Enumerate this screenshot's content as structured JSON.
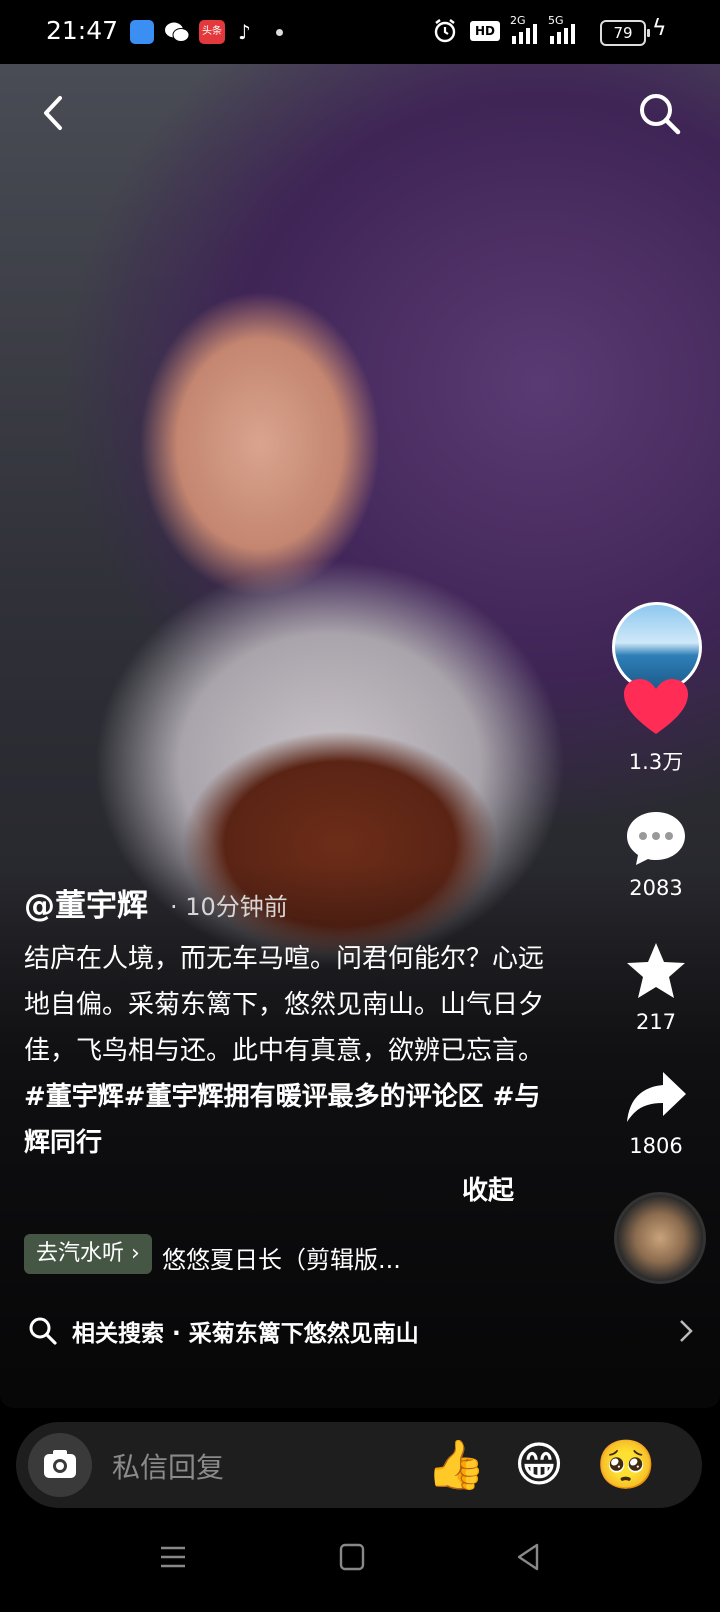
{
  "status_bar": {
    "time": "21:47",
    "toutiao_label": "头条",
    "hd_label": "HD",
    "signal_1": "2G",
    "signal_2": "5G",
    "battery": "79"
  },
  "post": {
    "author": "@董宇辉",
    "time_ago": "· 10分钟前",
    "caption_text": "结庐在人境，而无车马喧。问君何能尔？心远地自偏。采菊东篱下，悠然见南山。山气日夕佳，飞鸟相与还。此中有真意，欲辨已忘言。",
    "tag_1": "#董宇辉",
    "tag_2": "#董宇辉拥有暖评最多的评论区",
    "tag_3": " #与辉同行",
    "collapse_label": "收起",
    "music_chip": "去汽水听",
    "music_name": "悠悠夏日长（剪辑版..."
  },
  "rail": {
    "likes": "1.3万",
    "comments": "2083",
    "favorites": "217",
    "shares": "1806"
  },
  "related": {
    "label": "相关搜索 · 采菊东篱下悠然见南山"
  },
  "input": {
    "placeholder": "私信回复"
  },
  "colors": {
    "like": "#ff2c55",
    "background": "#000000",
    "chip": "#506450"
  }
}
